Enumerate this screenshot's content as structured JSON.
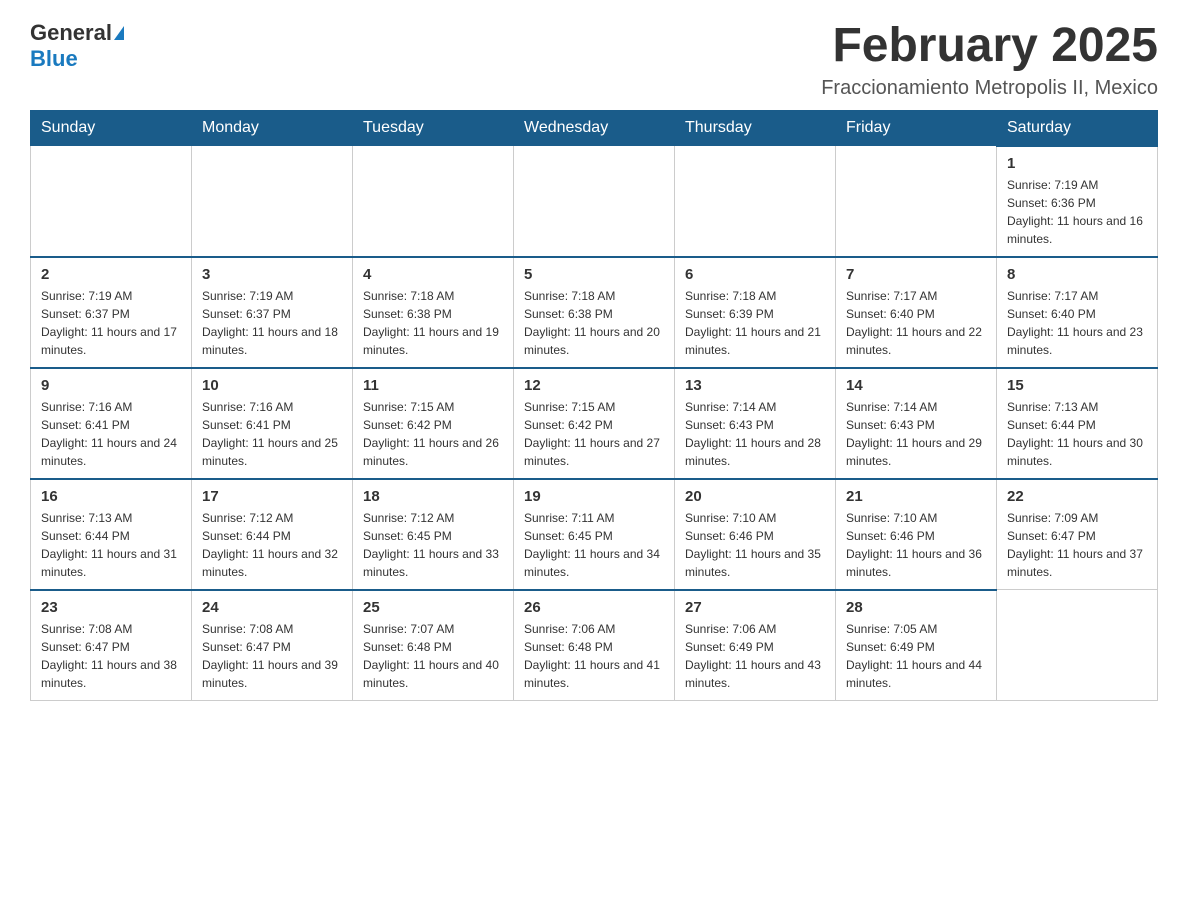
{
  "header": {
    "logo_general": "General",
    "logo_blue": "Blue",
    "month_title": "February 2025",
    "location": "Fraccionamiento Metropolis II, Mexico"
  },
  "days_of_week": [
    "Sunday",
    "Monday",
    "Tuesday",
    "Wednesday",
    "Thursday",
    "Friday",
    "Saturday"
  ],
  "weeks": [
    [
      {
        "day": "",
        "info": ""
      },
      {
        "day": "",
        "info": ""
      },
      {
        "day": "",
        "info": ""
      },
      {
        "day": "",
        "info": ""
      },
      {
        "day": "",
        "info": ""
      },
      {
        "day": "",
        "info": ""
      },
      {
        "day": "1",
        "info": "Sunrise: 7:19 AM\nSunset: 6:36 PM\nDaylight: 11 hours and 16 minutes."
      }
    ],
    [
      {
        "day": "2",
        "info": "Sunrise: 7:19 AM\nSunset: 6:37 PM\nDaylight: 11 hours and 17 minutes."
      },
      {
        "day": "3",
        "info": "Sunrise: 7:19 AM\nSunset: 6:37 PM\nDaylight: 11 hours and 18 minutes."
      },
      {
        "day": "4",
        "info": "Sunrise: 7:18 AM\nSunset: 6:38 PM\nDaylight: 11 hours and 19 minutes."
      },
      {
        "day": "5",
        "info": "Sunrise: 7:18 AM\nSunset: 6:38 PM\nDaylight: 11 hours and 20 minutes."
      },
      {
        "day": "6",
        "info": "Sunrise: 7:18 AM\nSunset: 6:39 PM\nDaylight: 11 hours and 21 minutes."
      },
      {
        "day": "7",
        "info": "Sunrise: 7:17 AM\nSunset: 6:40 PM\nDaylight: 11 hours and 22 minutes."
      },
      {
        "day": "8",
        "info": "Sunrise: 7:17 AM\nSunset: 6:40 PM\nDaylight: 11 hours and 23 minutes."
      }
    ],
    [
      {
        "day": "9",
        "info": "Sunrise: 7:16 AM\nSunset: 6:41 PM\nDaylight: 11 hours and 24 minutes."
      },
      {
        "day": "10",
        "info": "Sunrise: 7:16 AM\nSunset: 6:41 PM\nDaylight: 11 hours and 25 minutes."
      },
      {
        "day": "11",
        "info": "Sunrise: 7:15 AM\nSunset: 6:42 PM\nDaylight: 11 hours and 26 minutes."
      },
      {
        "day": "12",
        "info": "Sunrise: 7:15 AM\nSunset: 6:42 PM\nDaylight: 11 hours and 27 minutes."
      },
      {
        "day": "13",
        "info": "Sunrise: 7:14 AM\nSunset: 6:43 PM\nDaylight: 11 hours and 28 minutes."
      },
      {
        "day": "14",
        "info": "Sunrise: 7:14 AM\nSunset: 6:43 PM\nDaylight: 11 hours and 29 minutes."
      },
      {
        "day": "15",
        "info": "Sunrise: 7:13 AM\nSunset: 6:44 PM\nDaylight: 11 hours and 30 minutes."
      }
    ],
    [
      {
        "day": "16",
        "info": "Sunrise: 7:13 AM\nSunset: 6:44 PM\nDaylight: 11 hours and 31 minutes."
      },
      {
        "day": "17",
        "info": "Sunrise: 7:12 AM\nSunset: 6:44 PM\nDaylight: 11 hours and 32 minutes."
      },
      {
        "day": "18",
        "info": "Sunrise: 7:12 AM\nSunset: 6:45 PM\nDaylight: 11 hours and 33 minutes."
      },
      {
        "day": "19",
        "info": "Sunrise: 7:11 AM\nSunset: 6:45 PM\nDaylight: 11 hours and 34 minutes."
      },
      {
        "day": "20",
        "info": "Sunrise: 7:10 AM\nSunset: 6:46 PM\nDaylight: 11 hours and 35 minutes."
      },
      {
        "day": "21",
        "info": "Sunrise: 7:10 AM\nSunset: 6:46 PM\nDaylight: 11 hours and 36 minutes."
      },
      {
        "day": "22",
        "info": "Sunrise: 7:09 AM\nSunset: 6:47 PM\nDaylight: 11 hours and 37 minutes."
      }
    ],
    [
      {
        "day": "23",
        "info": "Sunrise: 7:08 AM\nSunset: 6:47 PM\nDaylight: 11 hours and 38 minutes."
      },
      {
        "day": "24",
        "info": "Sunrise: 7:08 AM\nSunset: 6:47 PM\nDaylight: 11 hours and 39 minutes."
      },
      {
        "day": "25",
        "info": "Sunrise: 7:07 AM\nSunset: 6:48 PM\nDaylight: 11 hours and 40 minutes."
      },
      {
        "day": "26",
        "info": "Sunrise: 7:06 AM\nSunset: 6:48 PM\nDaylight: 11 hours and 41 minutes."
      },
      {
        "day": "27",
        "info": "Sunrise: 7:06 AM\nSunset: 6:49 PM\nDaylight: 11 hours and 43 minutes."
      },
      {
        "day": "28",
        "info": "Sunrise: 7:05 AM\nSunset: 6:49 PM\nDaylight: 11 hours and 44 minutes."
      },
      {
        "day": "",
        "info": ""
      }
    ]
  ]
}
